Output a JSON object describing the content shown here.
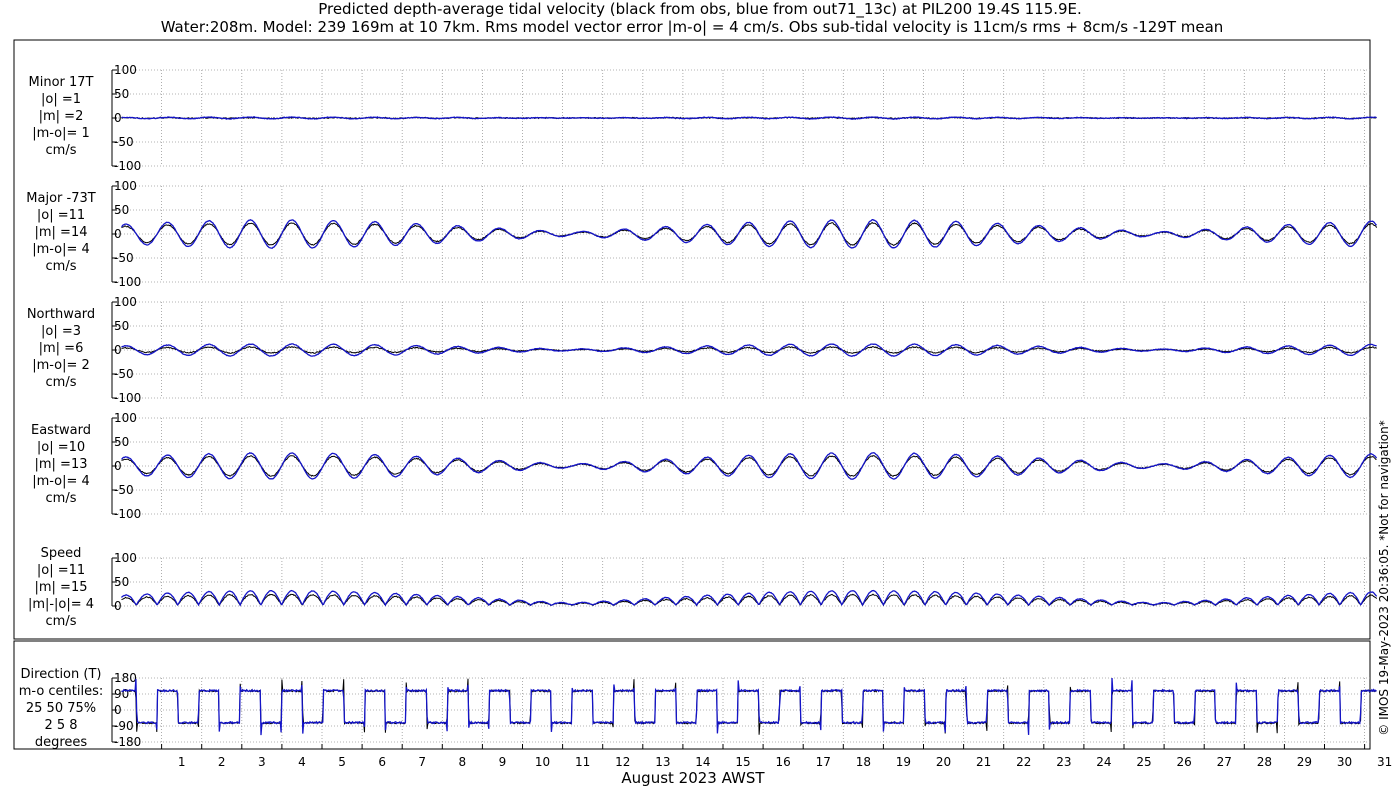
{
  "chart_data": {
    "type": "line",
    "title_lines": [
      "Predicted depth-average tidal velocity (black from obs, blue from out71_13c) at PIL200 19.4S 115.9E.",
      "Water:208m. Model: 239 169m at 10 7km. Rms model vector error |m-o| = 4 cm/s. Obs sub-tidal velocity is 11cm/s rms + 8cm/s -129T mean"
    ],
    "xlabel": "August 2023 AWST",
    "x_ticks": [
      "1",
      "2",
      "3",
      "4",
      "5",
      "6",
      "7",
      "8",
      "9",
      "10",
      "11",
      "12",
      "13",
      "14",
      "15",
      "16",
      "17",
      "18",
      "19",
      "20",
      "21",
      "22",
      "23",
      "24",
      "25",
      "26",
      "27",
      "28",
      "29",
      "30",
      "31"
    ],
    "xlim": [
      0,
      31.3
    ],
    "copyright": "© IMOS 19-May-2023 20:36:05.  *Not for navigation*",
    "colors": {
      "obs": "#000000",
      "model": "#1414c8"
    },
    "panels": [
      {
        "key": "minor",
        "labels": [
          "Minor 17T",
          "|o| =1",
          "|m| =2",
          "|m-o|= 1",
          "cm/s"
        ],
        "ylim": [
          -100,
          100
        ],
        "y_ticks": [
          "100",
          "50",
          "0",
          "-50",
          "-100"
        ],
        "y_tick_values": [
          100,
          50,
          0,
          -50,
          -100
        ],
        "amplitude": {
          "obs": 1,
          "model": 2
        }
      },
      {
        "key": "major",
        "labels": [
          "Major -73T",
          "|o| =11",
          "|m| =14",
          "|m-o|= 4",
          "cm/s"
        ],
        "ylim": [
          -100,
          100
        ],
        "y_ticks": [
          "100",
          "50",
          "0",
          "-50",
          "-100"
        ],
        "y_tick_values": [
          100,
          50,
          0,
          -50,
          -100
        ],
        "amplitude": {
          "obs": 11,
          "model": 14
        }
      },
      {
        "key": "northward",
        "labels": [
          "Northward",
          "|o| =3",
          "|m| =6",
          "|m-o|= 2",
          "cm/s"
        ],
        "ylim": [
          -100,
          100
        ],
        "y_ticks": [
          "100",
          "50",
          "0",
          "-50",
          "-100"
        ],
        "y_tick_values": [
          100,
          50,
          0,
          -50,
          -100
        ],
        "amplitude": {
          "obs": 3,
          "model": 6
        }
      },
      {
        "key": "eastward",
        "labels": [
          "Eastward",
          "|o| =10",
          "|m| =13",
          "|m-o|= 4",
          "cm/s"
        ],
        "ylim": [
          -100,
          100
        ],
        "y_ticks": [
          "100",
          "50",
          "0",
          "-50",
          "-100"
        ],
        "y_tick_values": [
          100,
          50,
          0,
          -50,
          -100
        ],
        "amplitude": {
          "obs": 10,
          "model": 13
        }
      },
      {
        "key": "speed",
        "labels": [
          "Speed",
          "|o| =11",
          "|m| =15",
          "|m|-|o|= 4",
          "cm/s"
        ],
        "ylim": [
          0,
          100
        ],
        "y_ticks": [
          "100",
          "50",
          "0"
        ],
        "y_tick_values": [
          100,
          50,
          0
        ],
        "amplitude": {
          "obs": 11,
          "model": 15
        }
      },
      {
        "key": "direction",
        "labels": [
          "Direction (T)",
          "m-o centiles:",
          "25  50  75%",
          "2   5   8",
          "degrees"
        ],
        "ylim": [
          -180,
          180
        ],
        "y_ticks": [
          "180",
          "90",
          "0",
          "-90",
          "-180"
        ],
        "y_tick_values": [
          180,
          90,
          0,
          -90,
          -180
        ],
        "direction_levels": [
          -73,
          107
        ]
      }
    ]
  }
}
